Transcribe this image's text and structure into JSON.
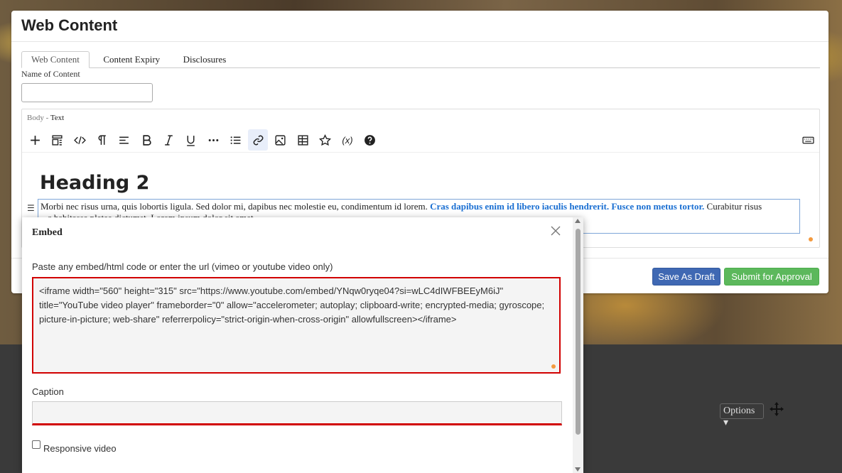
{
  "page": {
    "title": "Web Content",
    "tabs": [
      {
        "label": "Web Content",
        "active": true
      },
      {
        "label": "Content Expiry",
        "active": false
      },
      {
        "label": "Disclosures",
        "active": false
      }
    ],
    "name_label": "Name of Content",
    "name_value": ""
  },
  "editor": {
    "body_label": "Body - ",
    "mode_label": "Text",
    "toolbar": [
      "add-icon",
      "layout-icon",
      "code-icon",
      "paragraph-icon",
      "align-icon",
      "bold-icon",
      "italic-icon",
      "underline-icon",
      "more-icon",
      "list-icon",
      "link-icon",
      "image-icon",
      "table-icon",
      "star-icon",
      "variable-icon",
      "help-icon",
      "keyboard-icon"
    ],
    "heading": "Heading 2",
    "paragraph_start": "Morbi nec risus urna, quis lobortis ligula. Sed dolor mi, dapibus nec molestie eu, condimentum id lorem. ",
    "paragraph_bold": "Cras dapibus enim id libero iaculis hendrerit. Fusce non metus tortor.",
    "paragraph_end": " Curabitur risus",
    "paragraph_line2": "...c habitasse platea dictumst. Lorem ipsum dolor sit amet,"
  },
  "footer": {
    "save_draft": "Save As Draft",
    "submit": "Submit for Approval"
  },
  "background": {
    "options_label": "Options"
  },
  "embed_dialog": {
    "title": "Embed",
    "hint": "Paste any embed/html code or enter the url (vimeo or youtube video only)",
    "code_value": "<iframe width=\"560\" height=\"315\" src=\"https://www.youtube.com/embed/YNqw0ryqe04?si=wLC4dIWFBEEyM6iJ\" title=\"YouTube video player\" frameborder=\"0\" allow=\"accelerometer; autoplay; clipboard-write; encrypted-media; gyroscope; picture-in-picture; web-share\" referrerpolicy=\"strict-origin-when-cross-origin\" allowfullscreen></iframe>",
    "caption_label": "Caption",
    "caption_value": "",
    "responsive_label": "Responsive video",
    "responsive_checked": false
  },
  "colors": {
    "draft_button": "#3f68b3",
    "submit_button": "#5cb85c",
    "highlight_text": "#1a6fd2",
    "error_border": "#d10000"
  }
}
